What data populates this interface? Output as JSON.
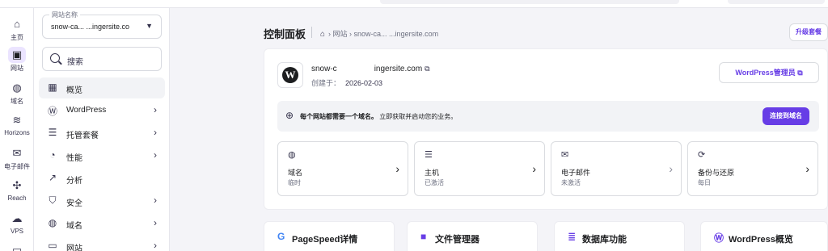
{
  "rail": {
    "items": [
      {
        "label": "主页",
        "icon": "⌂"
      },
      {
        "label": "网站",
        "icon": "▣"
      },
      {
        "label": "域名",
        "icon": "◍"
      },
      {
        "label": "Horizons",
        "icon": "≋"
      },
      {
        "label": "电子邮件",
        "icon": "✉"
      },
      {
        "label": "Reach",
        "icon": "✣"
      },
      {
        "label": "VPS",
        "icon": "☁"
      },
      {
        "label": "",
        "icon": "▭"
      }
    ]
  },
  "sidebar": {
    "site_select_label": "网站名称",
    "site_select_value": "snow-ca... ...ingersite.co",
    "search_label": "搜索",
    "items": [
      {
        "label": "概览",
        "icon": "▦",
        "chevron": ""
      },
      {
        "label": "WordPress",
        "icon": "Ⓦ",
        "chevron": "›"
      },
      {
        "label": "托管套餐",
        "icon": "☰",
        "chevron": "›"
      },
      {
        "label": "性能",
        "icon": "◔",
        "chevron": "›"
      },
      {
        "label": "分析",
        "icon": "↗",
        "chevron": ""
      },
      {
        "label": "安全",
        "icon": "⛉",
        "chevron": "›"
      },
      {
        "label": "域名",
        "icon": "◍",
        "chevron": "›"
      },
      {
        "label": "网站",
        "icon": "▭",
        "chevron": "›"
      }
    ]
  },
  "header": {
    "title": "控制面板",
    "crumb_home_icon": "⌂",
    "crumb_text": "› 网站 › snow-ca... ...ingersite.com",
    "upgrade_label": "升级套餐"
  },
  "site": {
    "logo_letter": "W",
    "name_prefix": "snow-c",
    "name_suffix": "ingersite.com",
    "external_icon": "⧉",
    "created_label": "创建于：",
    "created_date": "2026-02-03",
    "wp_admin_label": "WordPress管理员 ⧉"
  },
  "banner": {
    "icon": "⊕",
    "bold_text": "每个网站都需要一个域名。",
    "text": "立即获取并启动您的业务。",
    "button_label": "连接到域名"
  },
  "tiles": [
    {
      "icon": "◍",
      "title": "域名",
      "sub": "临时"
    },
    {
      "icon": "☰",
      "title": "主机",
      "sub": "已激活"
    },
    {
      "icon": "✉",
      "title": "电子邮件",
      "sub": "未激活"
    },
    {
      "icon": "⟳",
      "title": "备份与还原",
      "sub": "每日"
    }
  ],
  "quick": [
    {
      "icon": "G",
      "label": "PageSpeed详情",
      "color": "#4285f4"
    },
    {
      "icon": "■",
      "label": "文件管理器",
      "color": "#673de6"
    },
    {
      "icon": "≣",
      "label": "数据库功能",
      "color": "#673de6"
    },
    {
      "icon": "Ⓦ",
      "label": "WordPress概览",
      "color": "#673de6"
    }
  ],
  "colors": {
    "accent": "#673de6",
    "background": "#f4f4f8"
  }
}
